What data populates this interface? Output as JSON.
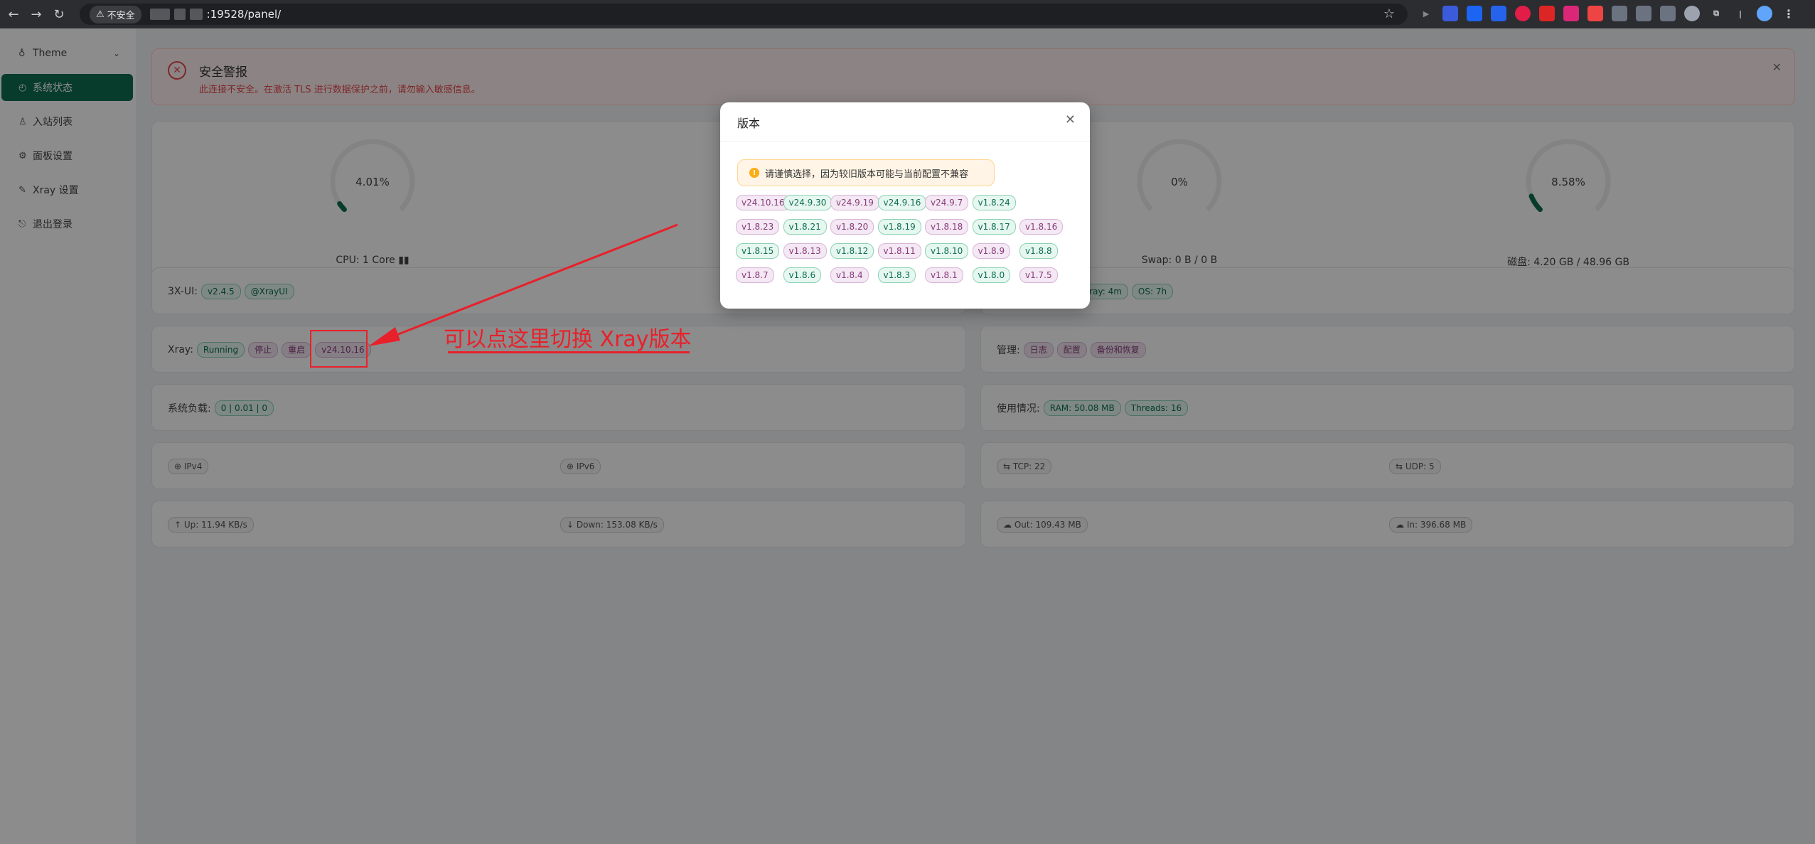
{
  "browser": {
    "insecure_label": "不安全",
    "url": ":19528/panel/"
  },
  "sidebar": {
    "items": [
      {
        "icon": "bulb-icon",
        "label": "Theme"
      },
      {
        "icon": "dashboard-icon",
        "label": "系统状态"
      },
      {
        "icon": "user-icon",
        "label": "入站列表"
      },
      {
        "icon": "gear-icon",
        "label": "面板设置"
      },
      {
        "icon": "tool-icon",
        "label": "Xray 设置"
      },
      {
        "icon": "logout-icon",
        "label": "退出登录"
      }
    ]
  },
  "alert": {
    "title": "安全警报",
    "message": "此连接不安全。在激活 TLS 进行数据保护之前，请勿输入敏感信息。"
  },
  "gauges": {
    "cpu": {
      "value": "4.01%",
      "percent": 4.01,
      "label": "CPU: 1 Core"
    },
    "swap": {
      "value": "0%",
      "percent": 0,
      "label": "Swap: 0 B / 0 B"
    },
    "disk": {
      "value": "8.58%",
      "percent": 8.58,
      "label": "磁盘: 4.20 GB / 48.96 GB"
    }
  },
  "info": {
    "threexui_label": "3X-UI:",
    "threexui_version": "v2.4.5",
    "threexui_handle": "@XrayUI",
    "uptime_xray": "Xray: 4m",
    "uptime_os": "OS: 7h",
    "xray_label": "Xray:",
    "xray_status": "Running",
    "xray_stop": "停止",
    "xray_restart": "重启",
    "xray_version": "v24.10.16",
    "manage_label": "管理:",
    "manage_logs": "日志",
    "manage_config": "配置",
    "manage_backup": "备份和恢复",
    "load_label": "系统负载:",
    "load_value": "0 | 0.01 | 0",
    "usage_label": "使用情况:",
    "usage_ram": "RAM: 50.08 MB",
    "usage_threads": "Threads: 16",
    "ipv4": "IPv4",
    "ipv6": "IPv6",
    "tcp": "TCP: 22",
    "udp": "UDP: 5",
    "up": "Up: 11.94 KB/s",
    "down": "Down: 153.08 KB/s",
    "out": "Out: 109.43 MB",
    "in": "In: 396.68 MB"
  },
  "modal": {
    "title": "版本",
    "warning": "请谨慎选择，因为较旧版本可能与当前配置不兼容",
    "versions": [
      "v24.10.16",
      "v24.9.30",
      "v24.9.19",
      "v24.9.16",
      "v24.9.7",
      "v1.8.24",
      "v1.8.23",
      "v1.8.21",
      "v1.8.20",
      "v1.8.19",
      "v1.8.18",
      "v1.8.17",
      "v1.8.16",
      "v1.8.15",
      "v1.8.13",
      "v1.8.12",
      "v1.8.11",
      "v1.8.10",
      "v1.8.9",
      "v1.8.8",
      "v1.8.7",
      "v1.8.6",
      "v1.8.4",
      "v1.8.3",
      "v1.8.1",
      "v1.8.0",
      "v1.7.5"
    ]
  },
  "annotation": {
    "text": "可以点这里切换 Xray版本"
  },
  "colors": {
    "accent": "#0d6e53",
    "danger": "#e5484d",
    "annotation": "#e8202a"
  }
}
